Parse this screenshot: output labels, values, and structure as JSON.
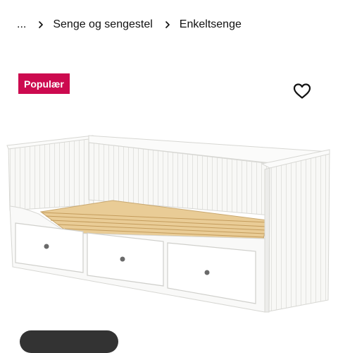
{
  "breadcrumb": {
    "ellipsis": "...",
    "items": [
      "Senge og sengestel",
      "Enkeltsenge"
    ]
  },
  "product": {
    "badge": "Populær",
    "badge_color": "#cc0a4f",
    "favorite_icon": "heart-outline-icon",
    "image_subject": "white day bed with three drawers"
  },
  "colors": {
    "frame": "#ffffff",
    "slats": "#e9cc96",
    "text": "#111111"
  }
}
